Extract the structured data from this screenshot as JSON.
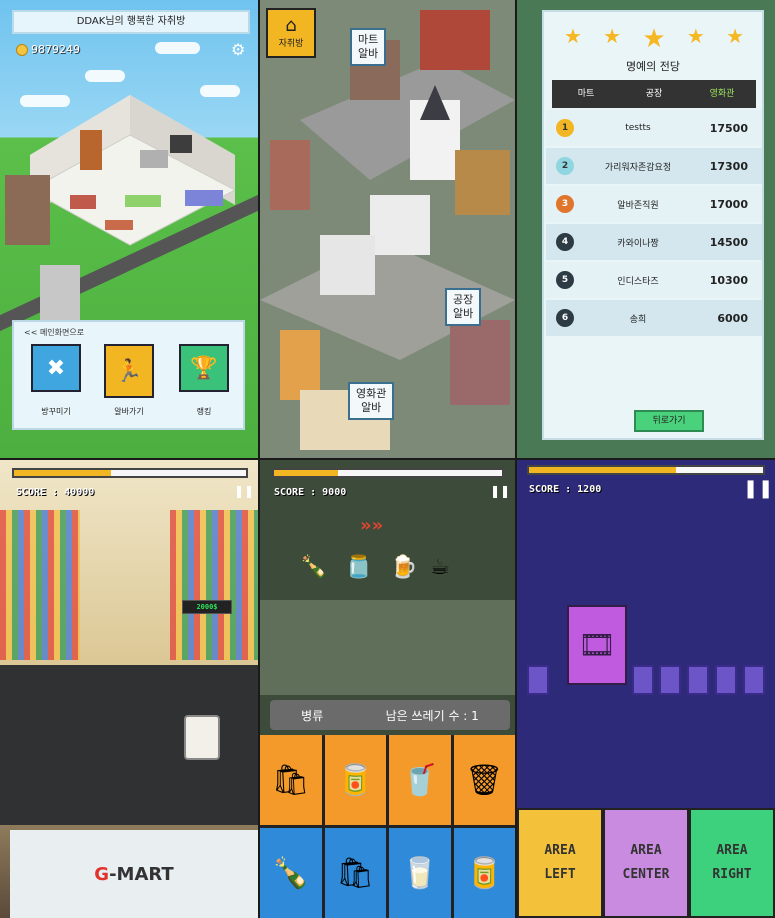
{
  "p1": {
    "title": "DDAK님의 행복한 자취방",
    "coins": "9879249",
    "menu_back": "<< 메인화면으로",
    "menu": [
      {
        "label": "방꾸미기",
        "icon": "tools-icon"
      },
      {
        "label": "알바가기",
        "icon": "running-icon"
      },
      {
        "label": "랭킹",
        "icon": "trophy-icon"
      }
    ],
    "colors": {
      "menu1": "#3fa6e0",
      "menu2": "#f3b623",
      "menu3": "#3ac27a"
    }
  },
  "p2": {
    "home_label": "자취방",
    "bubbles": [
      {
        "id": "mart",
        "line1": "마트",
        "line2": "알바"
      },
      {
        "id": "factory",
        "line1": "공장",
        "line2": "알바"
      },
      {
        "id": "cinema",
        "line1": "영화관",
        "line2": "알바"
      }
    ]
  },
  "p3": {
    "title": "명예의 전당",
    "tabs": [
      "마트",
      "공장",
      "영화관"
    ],
    "active_tab": "영화관",
    "ranks": [
      {
        "rank": "1",
        "name": "testts",
        "score": "17500"
      },
      {
        "rank": "2",
        "name": "가리워자존감요정",
        "score": "17300"
      },
      {
        "rank": "3",
        "name": "알바존직원",
        "score": "17000"
      },
      {
        "rank": "4",
        "name": "카와이나짱",
        "score": "14500"
      },
      {
        "rank": "5",
        "name": "인디스타즈",
        "score": "10300"
      },
      {
        "rank": "6",
        "name": "송희",
        "score": "6000"
      }
    ],
    "back_label": "뒤로가기"
  },
  "p4": {
    "progress": 0.42,
    "score": "SCORE : 40000",
    "scanner": "2000$",
    "brand_g": "G",
    "brand_rest": "-MART"
  },
  "p5": {
    "progress": 0.28,
    "score": "SCORE : 9000",
    "remain_type": "병류",
    "remain_text": "남은 쓰레기 수 : 1"
  },
  "p6": {
    "progress": 0.63,
    "score": "SCORE : 1200",
    "areas": [
      {
        "line1": "AREA",
        "line2": "LEFT",
        "color": "#f3c23a"
      },
      {
        "line1": "AREA",
        "line2": "CENTER",
        "color": "#c98be0"
      },
      {
        "line1": "AREA",
        "line2": "RIGHT",
        "color": "#3ed17d"
      }
    ]
  }
}
